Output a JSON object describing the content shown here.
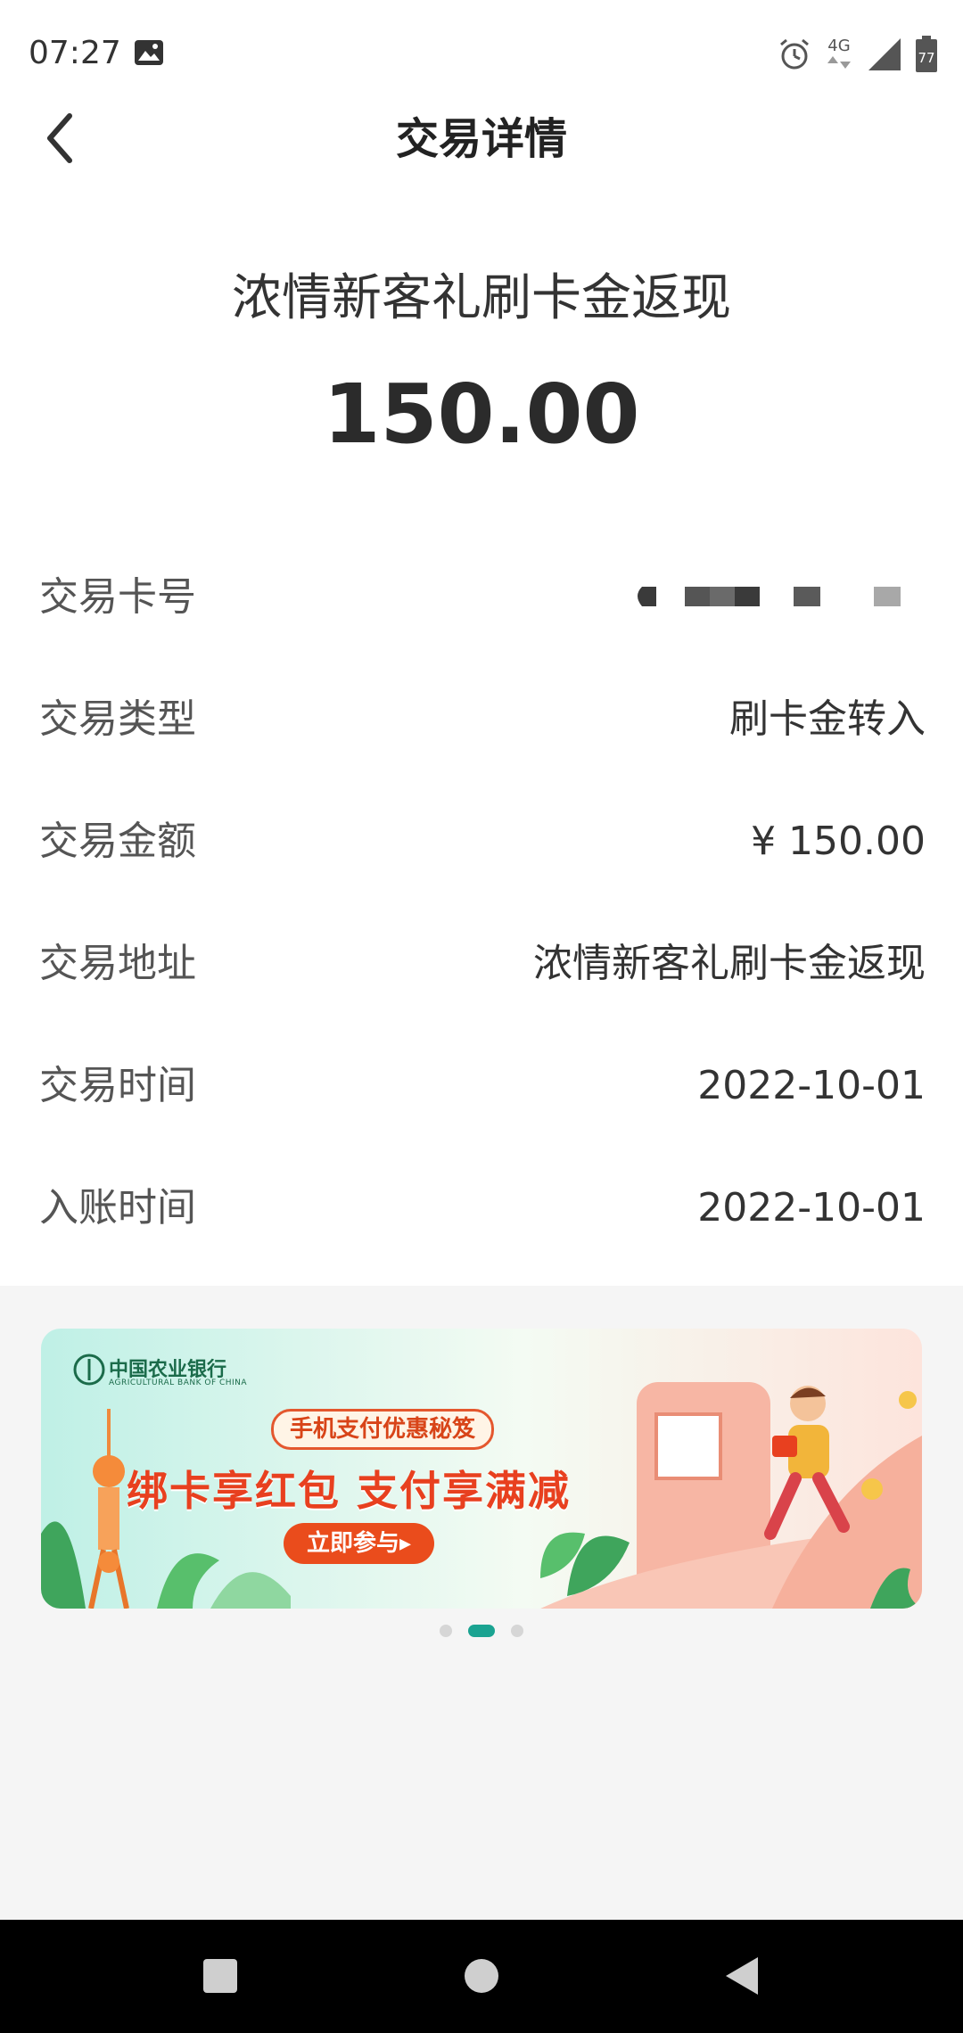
{
  "status_bar": {
    "time": "07:27",
    "network": "4G",
    "battery": "77",
    "icons": [
      "photo-icon",
      "alarm-icon",
      "signal-icon",
      "battery-icon"
    ]
  },
  "header": {
    "title": "交易详情",
    "back_icon": "chevron-left-icon"
  },
  "summary": {
    "name": "浓情新客礼刷卡金返现",
    "amount": "150.00"
  },
  "details": [
    {
      "label": "交易卡号",
      "value": ""
    },
    {
      "label": "交易类型",
      "value": "刷卡金转入"
    },
    {
      "label": "交易金额",
      "value": "¥ 150.00"
    },
    {
      "label": "交易地址",
      "value": "浓情新客礼刷卡金返现"
    },
    {
      "label": "交易时间",
      "value": "2022-10-01"
    },
    {
      "label": "入账时间",
      "value": "2022-10-01"
    }
  ],
  "banner": {
    "bank_name": "中国农业银行",
    "bank_name_en": "AGRICULTURAL BANK OF CHINA",
    "tag": "手机支付优惠秘笈",
    "headline": "绑卡享红包 支付享满减",
    "button": "立即参与▸",
    "page_count": 3,
    "active_page": 2
  },
  "nav_bar": {
    "buttons": [
      "recents-square-icon",
      "home-circle-icon",
      "back-triangle-icon"
    ]
  },
  "colors": {
    "accent": "#1aa391",
    "promo_red": "#e8401f",
    "grey_bg": "#f5f5f5"
  }
}
